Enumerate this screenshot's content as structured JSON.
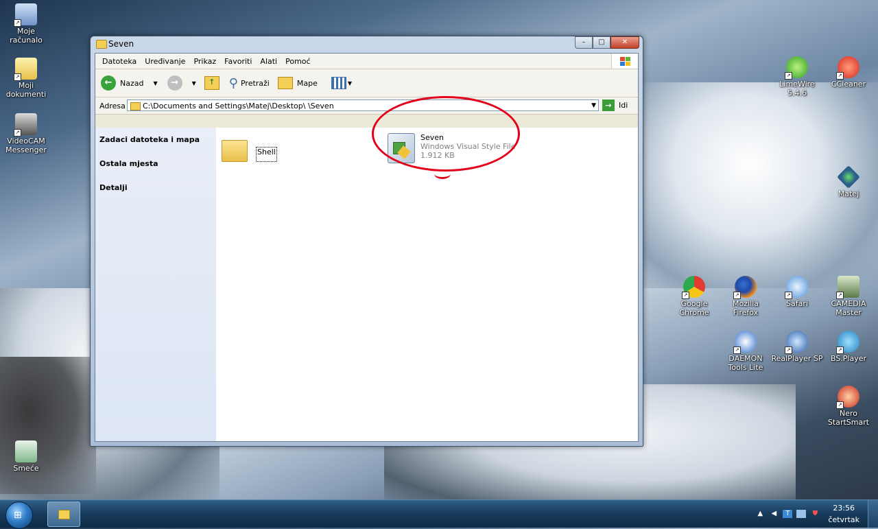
{
  "desktop": {
    "icons_left": [
      {
        "label": "Moje računalo"
      },
      {
        "label": "Moji dokumenti"
      },
      {
        "label": "VideoCAM Messenger"
      },
      {
        "label": "Smeće"
      }
    ],
    "icons_right": [
      {
        "label": "LimeWire 5.4.6"
      },
      {
        "label": "CCleaner"
      },
      {
        "label": "Matej"
      },
      {
        "label": "Google Chrome"
      },
      {
        "label": "Mozilla Firefox"
      },
      {
        "label": "Safari"
      },
      {
        "label": "CAMEDIA Master"
      },
      {
        "label": "DAEMON Tools Lite"
      },
      {
        "label": "RealPlayer SP"
      },
      {
        "label": "BS.Player"
      },
      {
        "label": "Nero StartSmart"
      }
    ]
  },
  "window": {
    "title": "Seven",
    "controls": {
      "minimize": "–",
      "maximize": "□",
      "close": "✕"
    },
    "menu": [
      "Datoteka",
      "Uređivanje",
      "Prikaz",
      "Favoriti",
      "Alati",
      "Pomoć"
    ],
    "toolbar": {
      "back": "Nazad",
      "search": "Pretraži",
      "folders": "Mape"
    },
    "address": {
      "label": "Adresa",
      "value": "C:\\Documents and Settings\\Matej\\Desktop\\ \\Seven",
      "go": "Idi"
    },
    "sidebar": [
      {
        "label": "Zadaci datoteka i mapa"
      },
      {
        "label": "Ostala mjesta"
      },
      {
        "label": "Detalji"
      }
    ],
    "files": [
      {
        "name": "Shell",
        "icon": "folder-icon"
      },
      {
        "name": "Seven",
        "type": "Windows Visual Style File",
        "size": "1.912 KB",
        "icon": "msstyles-file-icon"
      }
    ]
  },
  "taskbar": {
    "clock_time": "23:56",
    "clock_day": "četvrtak"
  },
  "colors": {
    "annotation": "#e3001b",
    "taskbar": "#173a5a"
  }
}
